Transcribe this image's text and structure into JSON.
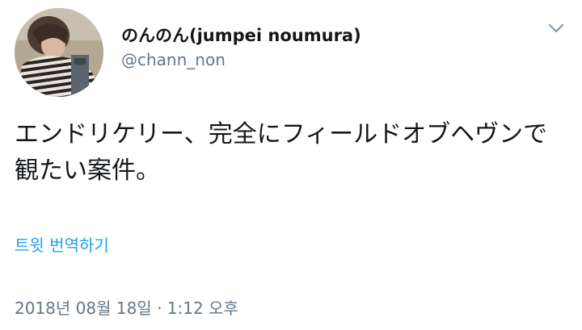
{
  "author": {
    "display_name": "のんのん(jumpei noumura)",
    "handle": "@chann_non"
  },
  "tweet": {
    "text": "エンドリケリー、完全にフィールドオブヘヴンで観たい案件。",
    "translate_label": "트윗 번역하기",
    "timestamp": "2018년 08월 18일 · 1:12 오후"
  },
  "icons": {
    "menu": "chevron-down-icon"
  },
  "colors": {
    "link": "#1da1f2",
    "secondary_text": "#657786",
    "primary_text": "#14171a"
  }
}
